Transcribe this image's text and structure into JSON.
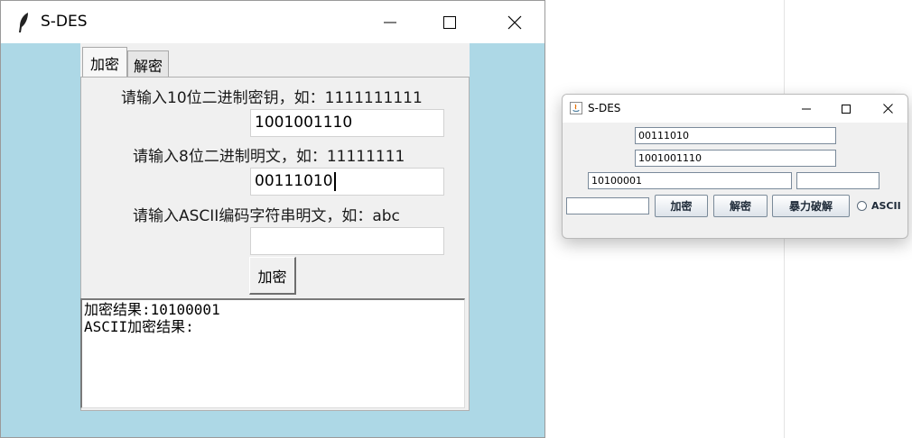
{
  "tk_window": {
    "title": "S-DES",
    "icon": "feather-icon",
    "controls": [
      "minimize-icon",
      "maximize-icon",
      "close-icon"
    ],
    "tabs": [
      {
        "label": "加密",
        "active": true
      },
      {
        "label": "解密",
        "active": false
      }
    ],
    "encrypt_panel": {
      "key_label": "请输入10位二进制密钥，如：1111111111",
      "key_value": "1001001110",
      "plaintext_label": "请输入8位二进制明文，如：11111111",
      "plaintext_value": "00111010",
      "ascii_label": "请输入ASCII编码字符串明文，如：abc",
      "ascii_value": "",
      "encrypt_button": "加密",
      "result_lines": [
        "加密结果:10100001",
        "ASCII加密结果:"
      ]
    },
    "colors": {
      "background": "#add8e6",
      "panel": "#f0f0f0"
    }
  },
  "swing_window": {
    "title": "S-DES",
    "icon": "java-icon",
    "controls": [
      "minimize-icon",
      "maximize-icon",
      "close-icon"
    ],
    "plaintext_field": "00111010",
    "key_field": "1001001110",
    "result_field": "10100001",
    "result_field_2": "",
    "input_field_left": "",
    "encrypt_button": "加密",
    "decrypt_button": "解密",
    "brute_force_button": "暴力破解",
    "ascii_radio_label": "ASCII",
    "ascii_selected": false
  }
}
